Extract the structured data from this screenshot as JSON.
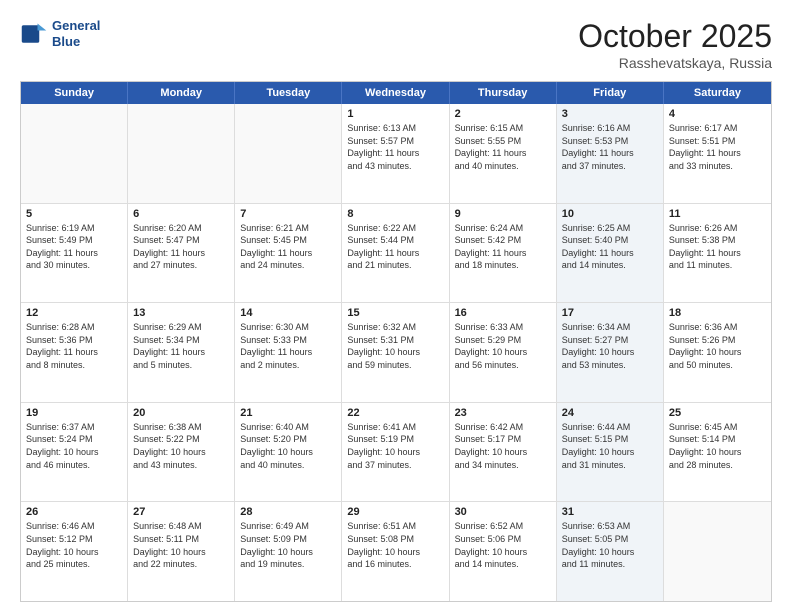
{
  "logo": {
    "line1": "General",
    "line2": "Blue"
  },
  "title": "October 2025",
  "subtitle": "Rasshevatskaya, Russia",
  "days_of_week": [
    "Sunday",
    "Monday",
    "Tuesday",
    "Wednesday",
    "Thursday",
    "Friday",
    "Saturday"
  ],
  "weeks": [
    [
      {
        "day": "",
        "info": "",
        "shaded": false,
        "empty": true
      },
      {
        "day": "",
        "info": "",
        "shaded": false,
        "empty": true
      },
      {
        "day": "",
        "info": "",
        "shaded": false,
        "empty": true
      },
      {
        "day": "1",
        "info": "Sunrise: 6:13 AM\nSunset: 5:57 PM\nDaylight: 11 hours\nand 43 minutes.",
        "shaded": false,
        "empty": false
      },
      {
        "day": "2",
        "info": "Sunrise: 6:15 AM\nSunset: 5:55 PM\nDaylight: 11 hours\nand 40 minutes.",
        "shaded": false,
        "empty": false
      },
      {
        "day": "3",
        "info": "Sunrise: 6:16 AM\nSunset: 5:53 PM\nDaylight: 11 hours\nand 37 minutes.",
        "shaded": true,
        "empty": false
      },
      {
        "day": "4",
        "info": "Sunrise: 6:17 AM\nSunset: 5:51 PM\nDaylight: 11 hours\nand 33 minutes.",
        "shaded": false,
        "empty": false
      }
    ],
    [
      {
        "day": "5",
        "info": "Sunrise: 6:19 AM\nSunset: 5:49 PM\nDaylight: 11 hours\nand 30 minutes.",
        "shaded": false,
        "empty": false
      },
      {
        "day": "6",
        "info": "Sunrise: 6:20 AM\nSunset: 5:47 PM\nDaylight: 11 hours\nand 27 minutes.",
        "shaded": false,
        "empty": false
      },
      {
        "day": "7",
        "info": "Sunrise: 6:21 AM\nSunset: 5:45 PM\nDaylight: 11 hours\nand 24 minutes.",
        "shaded": false,
        "empty": false
      },
      {
        "day": "8",
        "info": "Sunrise: 6:22 AM\nSunset: 5:44 PM\nDaylight: 11 hours\nand 21 minutes.",
        "shaded": false,
        "empty": false
      },
      {
        "day": "9",
        "info": "Sunrise: 6:24 AM\nSunset: 5:42 PM\nDaylight: 11 hours\nand 18 minutes.",
        "shaded": false,
        "empty": false
      },
      {
        "day": "10",
        "info": "Sunrise: 6:25 AM\nSunset: 5:40 PM\nDaylight: 11 hours\nand 14 minutes.",
        "shaded": true,
        "empty": false
      },
      {
        "day": "11",
        "info": "Sunrise: 6:26 AM\nSunset: 5:38 PM\nDaylight: 11 hours\nand 11 minutes.",
        "shaded": false,
        "empty": false
      }
    ],
    [
      {
        "day": "12",
        "info": "Sunrise: 6:28 AM\nSunset: 5:36 PM\nDaylight: 11 hours\nand 8 minutes.",
        "shaded": false,
        "empty": false
      },
      {
        "day": "13",
        "info": "Sunrise: 6:29 AM\nSunset: 5:34 PM\nDaylight: 11 hours\nand 5 minutes.",
        "shaded": false,
        "empty": false
      },
      {
        "day": "14",
        "info": "Sunrise: 6:30 AM\nSunset: 5:33 PM\nDaylight: 11 hours\nand 2 minutes.",
        "shaded": false,
        "empty": false
      },
      {
        "day": "15",
        "info": "Sunrise: 6:32 AM\nSunset: 5:31 PM\nDaylight: 10 hours\nand 59 minutes.",
        "shaded": false,
        "empty": false
      },
      {
        "day": "16",
        "info": "Sunrise: 6:33 AM\nSunset: 5:29 PM\nDaylight: 10 hours\nand 56 minutes.",
        "shaded": false,
        "empty": false
      },
      {
        "day": "17",
        "info": "Sunrise: 6:34 AM\nSunset: 5:27 PM\nDaylight: 10 hours\nand 53 minutes.",
        "shaded": true,
        "empty": false
      },
      {
        "day": "18",
        "info": "Sunrise: 6:36 AM\nSunset: 5:26 PM\nDaylight: 10 hours\nand 50 minutes.",
        "shaded": false,
        "empty": false
      }
    ],
    [
      {
        "day": "19",
        "info": "Sunrise: 6:37 AM\nSunset: 5:24 PM\nDaylight: 10 hours\nand 46 minutes.",
        "shaded": false,
        "empty": false
      },
      {
        "day": "20",
        "info": "Sunrise: 6:38 AM\nSunset: 5:22 PM\nDaylight: 10 hours\nand 43 minutes.",
        "shaded": false,
        "empty": false
      },
      {
        "day": "21",
        "info": "Sunrise: 6:40 AM\nSunset: 5:20 PM\nDaylight: 10 hours\nand 40 minutes.",
        "shaded": false,
        "empty": false
      },
      {
        "day": "22",
        "info": "Sunrise: 6:41 AM\nSunset: 5:19 PM\nDaylight: 10 hours\nand 37 minutes.",
        "shaded": false,
        "empty": false
      },
      {
        "day": "23",
        "info": "Sunrise: 6:42 AM\nSunset: 5:17 PM\nDaylight: 10 hours\nand 34 minutes.",
        "shaded": false,
        "empty": false
      },
      {
        "day": "24",
        "info": "Sunrise: 6:44 AM\nSunset: 5:15 PM\nDaylight: 10 hours\nand 31 minutes.",
        "shaded": true,
        "empty": false
      },
      {
        "day": "25",
        "info": "Sunrise: 6:45 AM\nSunset: 5:14 PM\nDaylight: 10 hours\nand 28 minutes.",
        "shaded": false,
        "empty": false
      }
    ],
    [
      {
        "day": "26",
        "info": "Sunrise: 6:46 AM\nSunset: 5:12 PM\nDaylight: 10 hours\nand 25 minutes.",
        "shaded": false,
        "empty": false
      },
      {
        "day": "27",
        "info": "Sunrise: 6:48 AM\nSunset: 5:11 PM\nDaylight: 10 hours\nand 22 minutes.",
        "shaded": false,
        "empty": false
      },
      {
        "day": "28",
        "info": "Sunrise: 6:49 AM\nSunset: 5:09 PM\nDaylight: 10 hours\nand 19 minutes.",
        "shaded": false,
        "empty": false
      },
      {
        "day": "29",
        "info": "Sunrise: 6:51 AM\nSunset: 5:08 PM\nDaylight: 10 hours\nand 16 minutes.",
        "shaded": false,
        "empty": false
      },
      {
        "day": "30",
        "info": "Sunrise: 6:52 AM\nSunset: 5:06 PM\nDaylight: 10 hours\nand 14 minutes.",
        "shaded": false,
        "empty": false
      },
      {
        "day": "31",
        "info": "Sunrise: 6:53 AM\nSunset: 5:05 PM\nDaylight: 10 hours\nand 11 minutes.",
        "shaded": true,
        "empty": false
      },
      {
        "day": "",
        "info": "",
        "shaded": false,
        "empty": true
      }
    ]
  ]
}
